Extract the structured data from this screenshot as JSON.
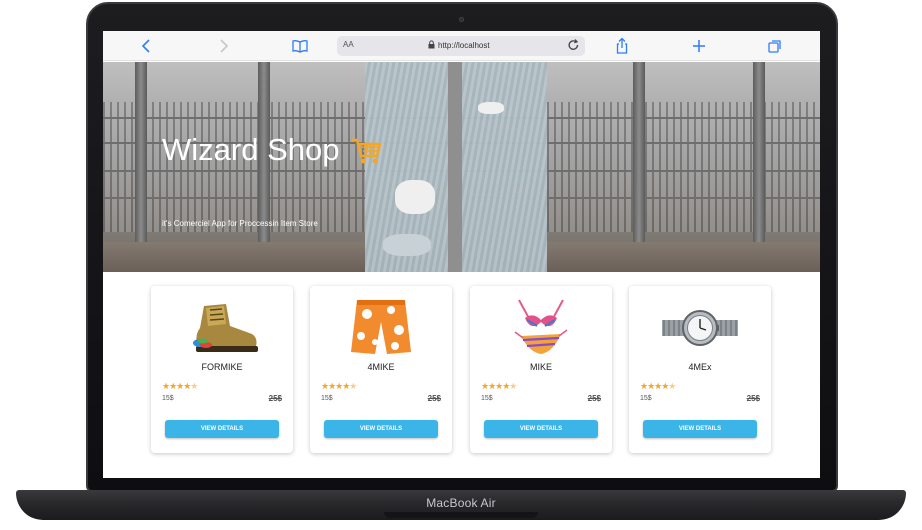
{
  "device": {
    "model_label": "MacBook Air"
  },
  "browser": {
    "text_size_label": "AA",
    "url": "http://localhost"
  },
  "hero": {
    "title": "Wizard Shop",
    "subtitle": "it's Comerciel App for Proccessin Item Store"
  },
  "products": [
    {
      "name": "FORMIKE",
      "rating": 4.5,
      "price": "15$",
      "old_price": "25$",
      "button_label": "VIEW DETAILS",
      "icon": "boot-icon"
    },
    {
      "name": "4MIKE",
      "rating": 4.5,
      "price": "15$",
      "old_price": "25$",
      "button_label": "VIEW DETAILS",
      "icon": "shorts-icon"
    },
    {
      "name": "MIKE",
      "rating": 4.5,
      "price": "15$",
      "old_price": "25$",
      "button_label": "VIEW DETAILS",
      "icon": "bikini-icon"
    },
    {
      "name": "4MEx",
      "rating": 4.5,
      "price": "15$",
      "old_price": "25$",
      "button_label": "VIEW DETAILS",
      "icon": "watch-icon"
    }
  ],
  "colors": {
    "accent": "#3bb4e8",
    "star": "#f5a623",
    "browser_blue": "#2f7cf6"
  }
}
